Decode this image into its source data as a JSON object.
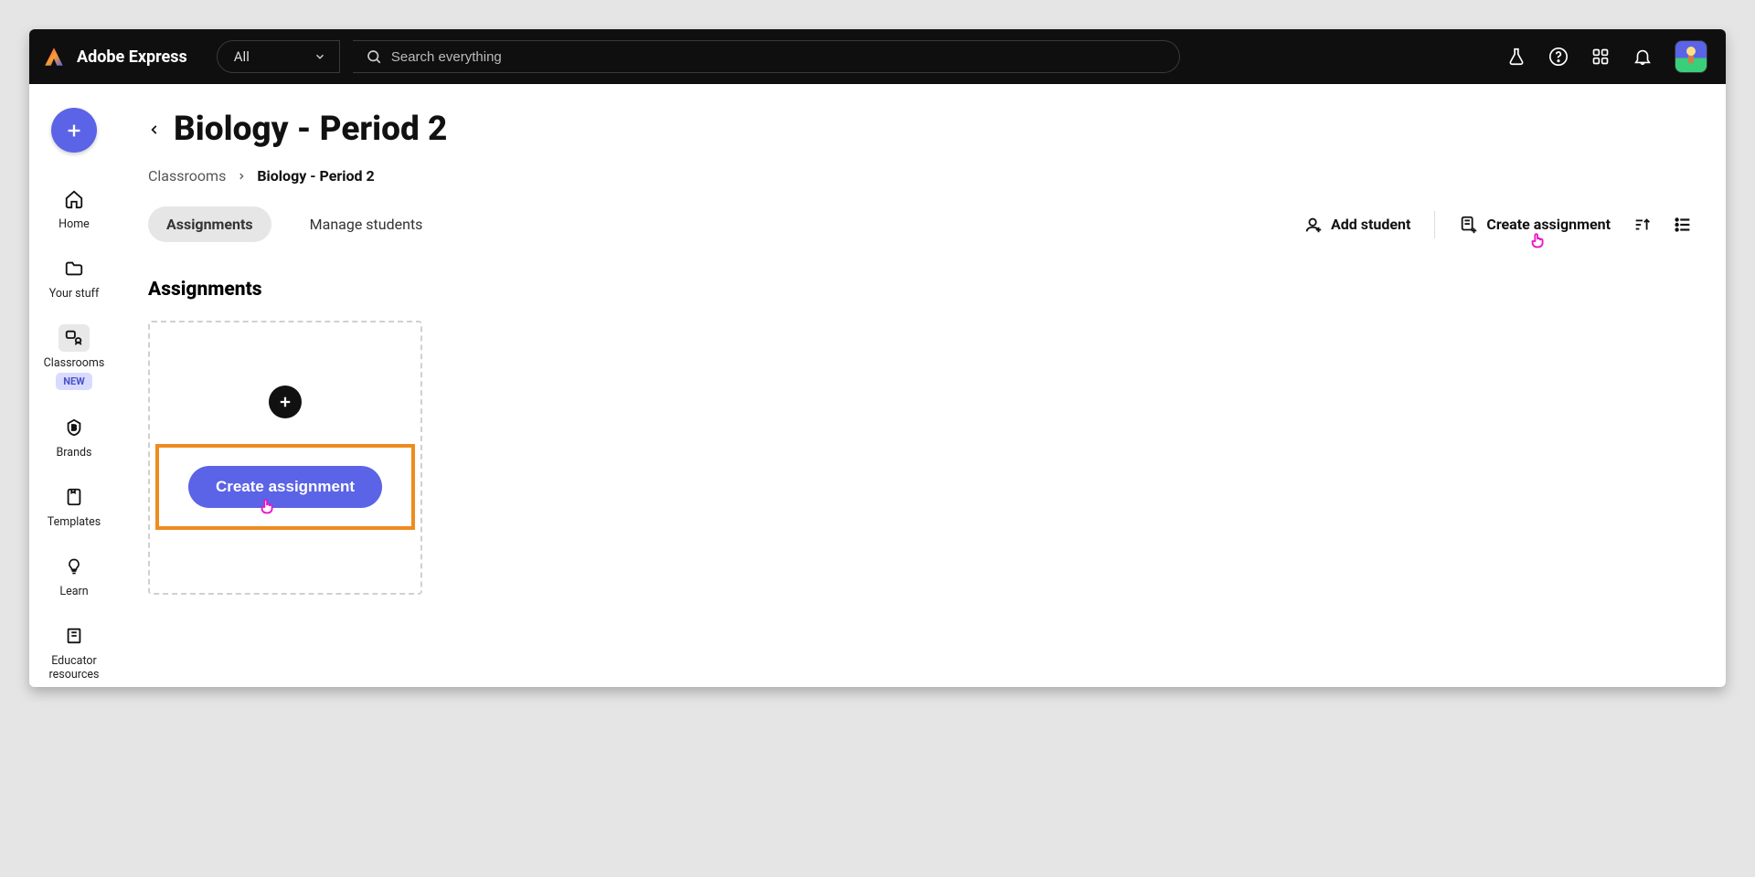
{
  "header": {
    "brand": "Adobe Express",
    "filter_label": "All",
    "search_placeholder": "Search everything"
  },
  "sidebar": {
    "items": [
      {
        "label": "Home"
      },
      {
        "label": "Your stuff"
      },
      {
        "label": "Classrooms",
        "badge": "NEW"
      },
      {
        "label": "Brands"
      },
      {
        "label": "Templates"
      },
      {
        "label": "Learn"
      },
      {
        "label": "Educator resources"
      }
    ]
  },
  "page": {
    "title": "Biology - Period 2",
    "breadcrumb_root": "Classrooms",
    "breadcrumb_current": "Biology - Period 2"
  },
  "tabs": {
    "assignments": "Assignments",
    "manage_students": "Manage students"
  },
  "actions": {
    "add_student": "Add student",
    "create_assignment": "Create assignment"
  },
  "section": {
    "assignments_title": "Assignments",
    "create_button": "Create assignment"
  }
}
